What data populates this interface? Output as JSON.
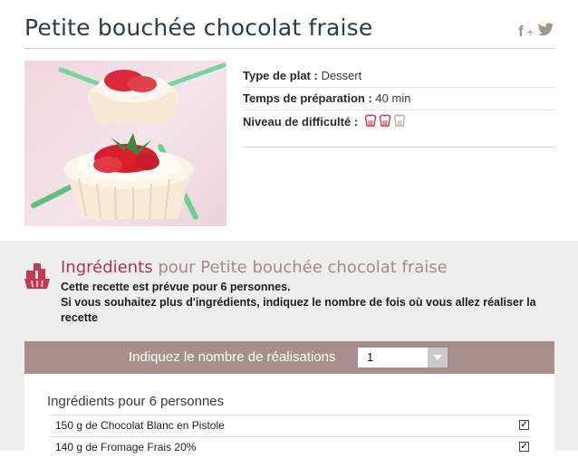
{
  "header": {
    "title": "Petite bouchée chocolat fraise",
    "social": {
      "facebook_label": "f",
      "plus_label": "+",
      "icon": "twitter-icon"
    }
  },
  "photo": {
    "alt_icon": "dessert-photo"
  },
  "info": {
    "dish_type_label": "Type de plat :",
    "dish_type_value": "Dessert",
    "prep_time_label": "Temps de préparation :",
    "prep_time_value": "40 min",
    "difficulty_label": "Niveau de difficulté :",
    "difficulty_level": 2,
    "difficulty_max": 3,
    "difficulty_icon": "chef-hat-icon",
    "accent_color": "#c8374f",
    "inactive_color": "#b9ada8"
  },
  "ingredients": {
    "heading_accent": "Ingrédients",
    "heading_rest": "pour Petite bouchée chocolat fraise",
    "intro_line1": "Cette recette est prévue pour 6 personnes.",
    "intro_line2": "Si vous souhaitez plus d'ingrédients, indiquez le nombre de fois où vous allez réaliser la recette",
    "realisations_label": "Indiquez le nombre de réalisations",
    "realisations_value": "1",
    "list_title": "Ingrédients pour 6 personnes",
    "items": [
      {
        "text": "150 g de Chocolat Blanc en Pistole",
        "checked": true
      },
      {
        "text": "140 g de Fromage Frais 20%",
        "checked": true
      }
    ]
  },
  "colors": {
    "title": "#2f3a4a",
    "accent": "#b3334e",
    "muted_heading": "#a38a86",
    "bar": "#a98f8b",
    "background": "#efeeee"
  }
}
